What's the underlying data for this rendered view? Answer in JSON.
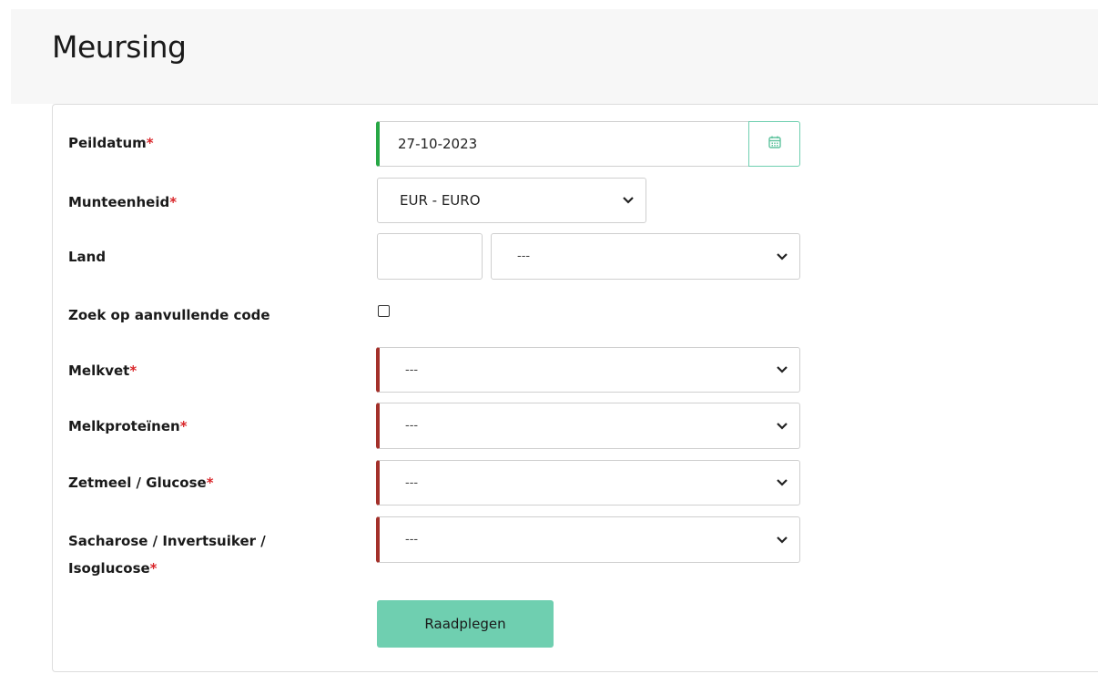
{
  "page": {
    "title": "Meursing"
  },
  "form": {
    "peildatum": {
      "label": "Peildatum",
      "required_mark": "*",
      "value": "27-10-2023",
      "calendar_icon": "calendar-icon"
    },
    "munteenheid": {
      "label": "Munteenheid",
      "required_mark": "*",
      "selected": "EUR - EURO"
    },
    "land": {
      "label": "Land",
      "code_value": "",
      "selected": "---"
    },
    "aanvullende_code": {
      "label": "Zoek op aanvullende code",
      "checked": false
    },
    "melkvet": {
      "label": "Melkvet",
      "required_mark": "*",
      "selected": "---"
    },
    "melkproteinen": {
      "label": "Melkproteïnen",
      "required_mark": "*",
      "selected": "---"
    },
    "zetmeel": {
      "label": "Zetmeel / Glucose",
      "required_mark": "*",
      "selected": "---"
    },
    "sacharose": {
      "label_line1": "Sacharose / Invertsuiker /",
      "label_line2": "Isoglucose",
      "required_mark": "*",
      "selected": "---"
    },
    "submit_label": "Raadplegen"
  },
  "colors": {
    "accent": "#6fcfb0",
    "valid": "#27a745",
    "invalid": "#a3302a",
    "required": "#d9262a"
  }
}
